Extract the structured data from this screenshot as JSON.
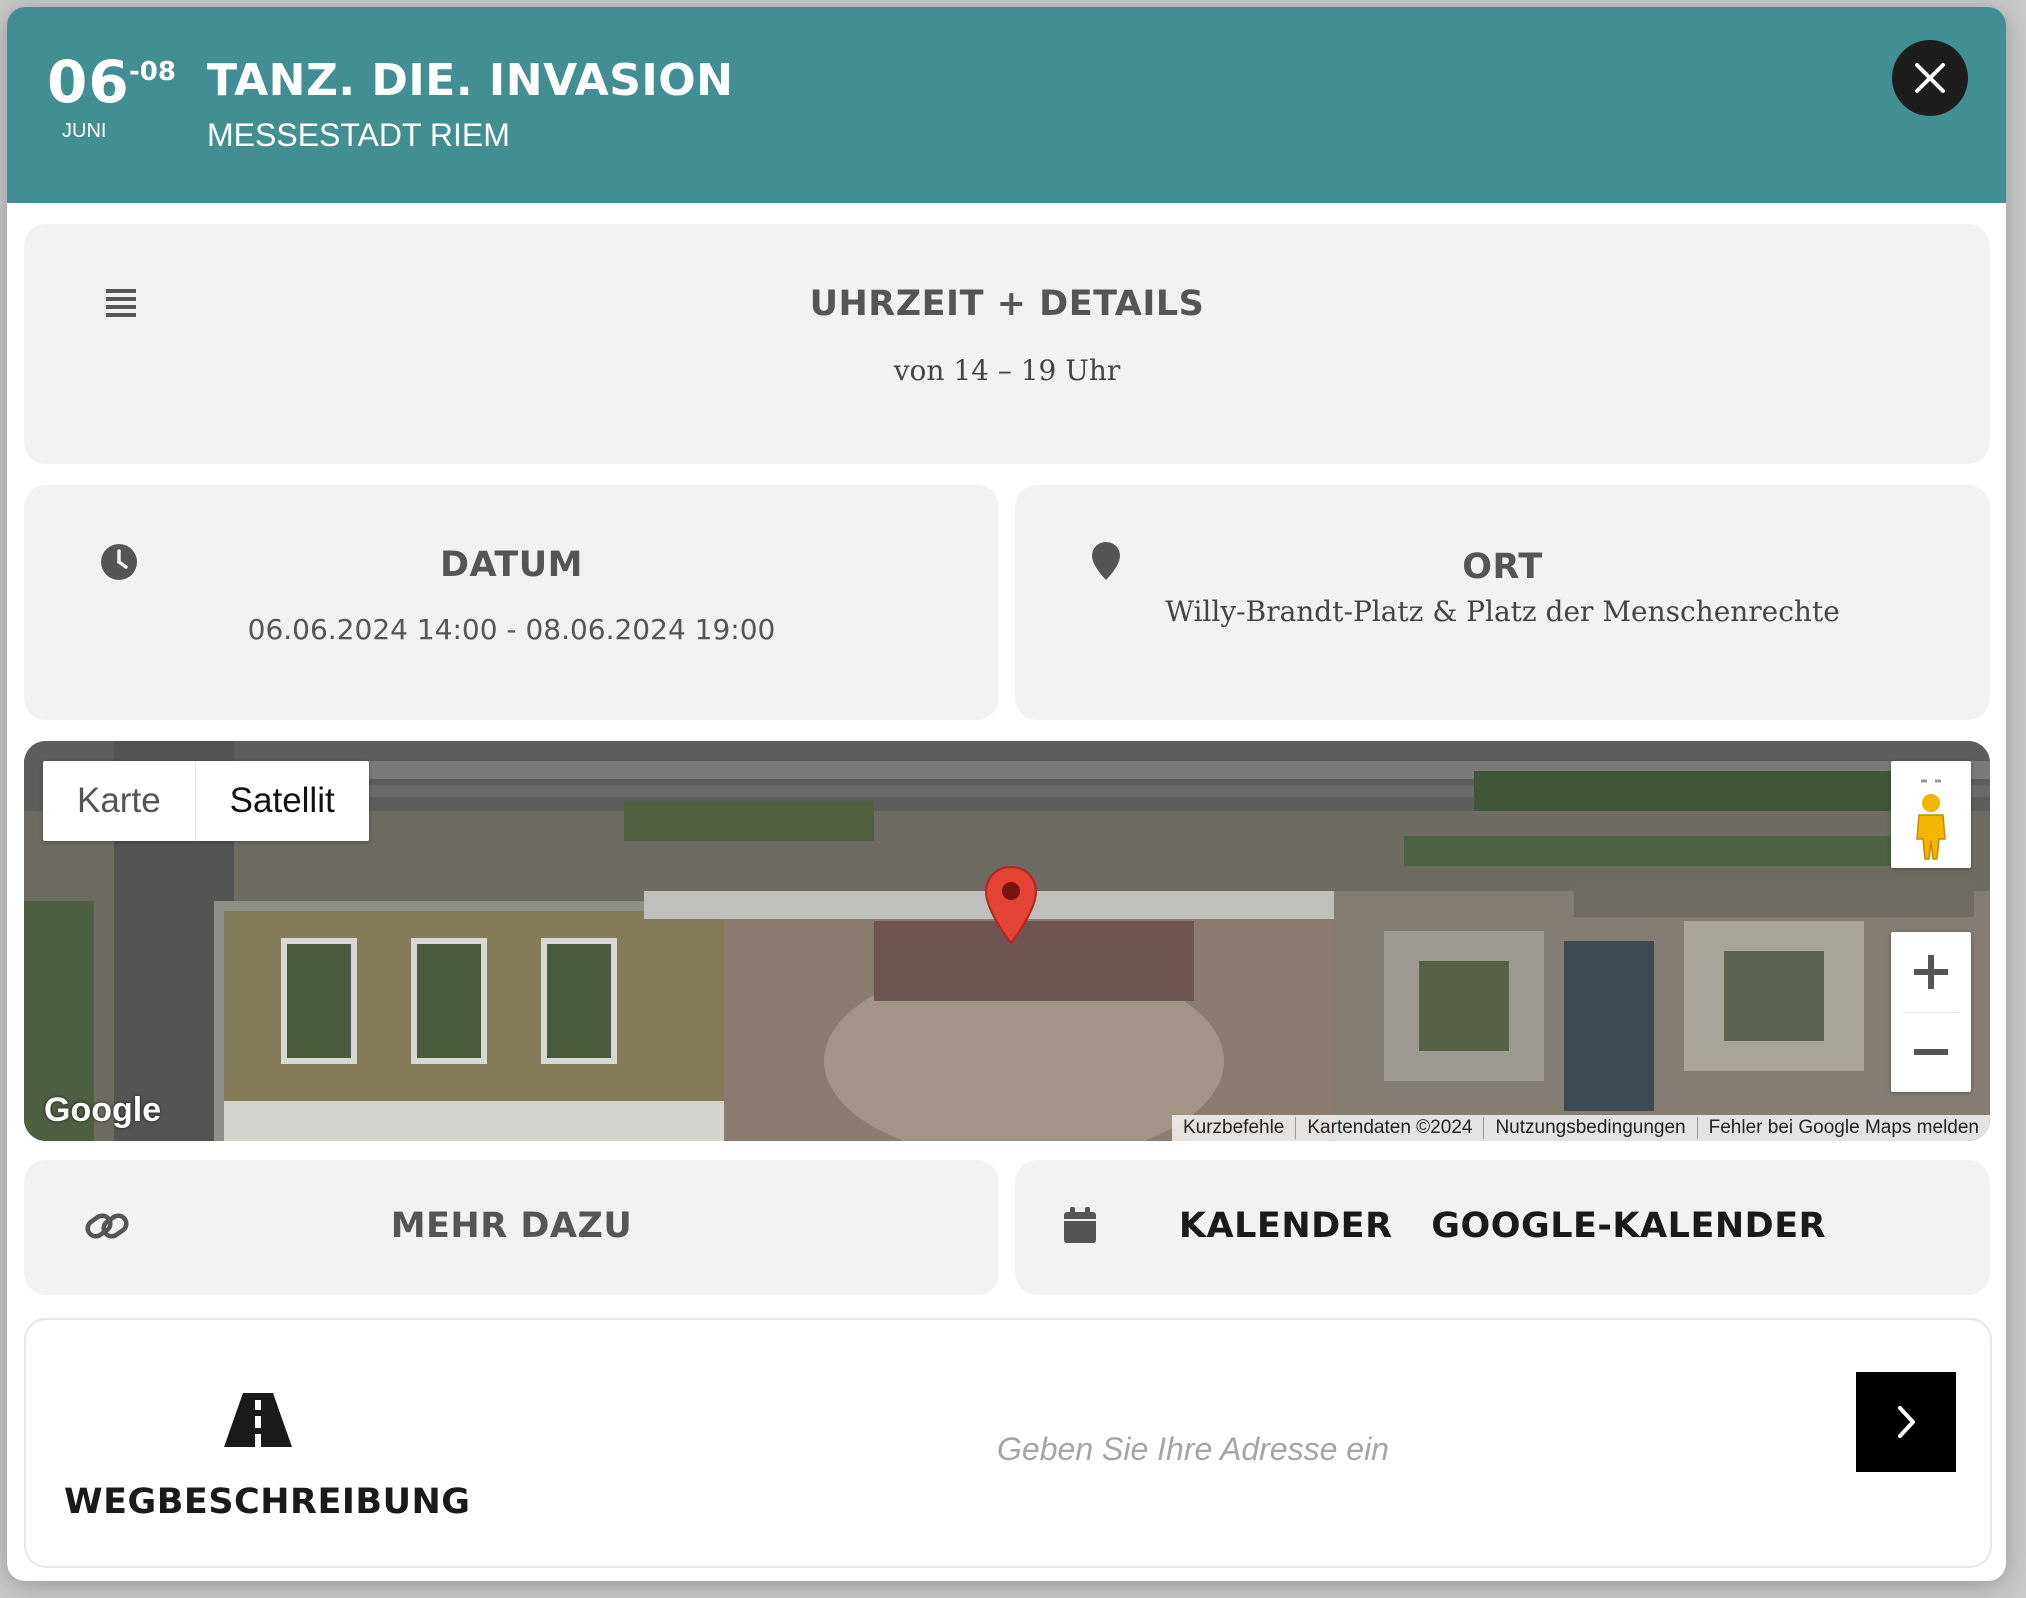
{
  "header": {
    "day_start": "06",
    "day_end": "-08",
    "month": "JUNI",
    "title": "TANZ. DIE. INVASION",
    "venue": "MESSESTADT RIEM",
    "accent_color": "#428f93"
  },
  "details": {
    "title": "UHRZEIT + DETAILS",
    "text": "von 14 – 19 Uhr",
    "icon": "list-icon"
  },
  "date_card": {
    "title": "DATUM",
    "text": "06.06.2024 14:00 - 08.06.2024 19:00",
    "icon": "clock-icon"
  },
  "place_card": {
    "title": "ORT",
    "text": "Willy-Brandt-Platz & Platz der Menschenrechte",
    "icon": "map-pin-icon"
  },
  "map": {
    "tabs": [
      "Karte",
      "Satellit"
    ],
    "selected_tab": "Satellit",
    "logo": "Google",
    "attribution": [
      "Kurzbefehle",
      "Kartendaten ©2024",
      "Nutzungsbedingungen",
      "Fehler bei Google Maps melden"
    ]
  },
  "more_card": {
    "title": "MEHR DAZU",
    "icon": "link-icon"
  },
  "calendar_card": {
    "label1": "KALENDER",
    "label2": "GOOGLE-KALENDER",
    "icon": "calendar-icon"
  },
  "route": {
    "title": "WEGBESCHREIBUNG",
    "placeholder": "Geben Sie Ihre Adresse ein",
    "value": "",
    "icon": "road-icon",
    "go_icon": "chevron-right-icon"
  }
}
